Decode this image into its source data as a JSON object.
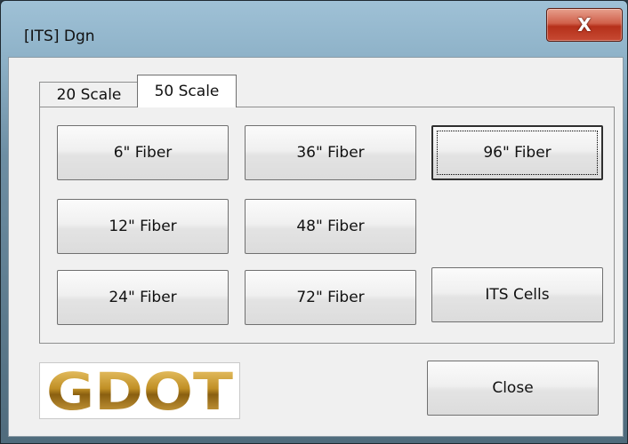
{
  "window": {
    "title": "[ITS] Dgn",
    "close_glyph": "X"
  },
  "tabs": [
    {
      "label": "20 Scale",
      "selected": false
    },
    {
      "label": "50 Scale",
      "selected": true
    }
  ],
  "buttons": {
    "fiber_6": "6\" Fiber",
    "fiber_36": "36\" Fiber",
    "fiber_96": "96\" Fiber",
    "fiber_12": "12\" Fiber",
    "fiber_48": "48\" Fiber",
    "fiber_24": "24\" Fiber",
    "fiber_72": "72\" Fiber",
    "its_cells": "ITS Cells",
    "close": "Close"
  },
  "focused_button": "fiber_96",
  "logo": {
    "text": "GDOT",
    "color": "#b8861b"
  },
  "colors": {
    "close_button": "#c74a33",
    "client_bg": "#f0f0f0"
  }
}
